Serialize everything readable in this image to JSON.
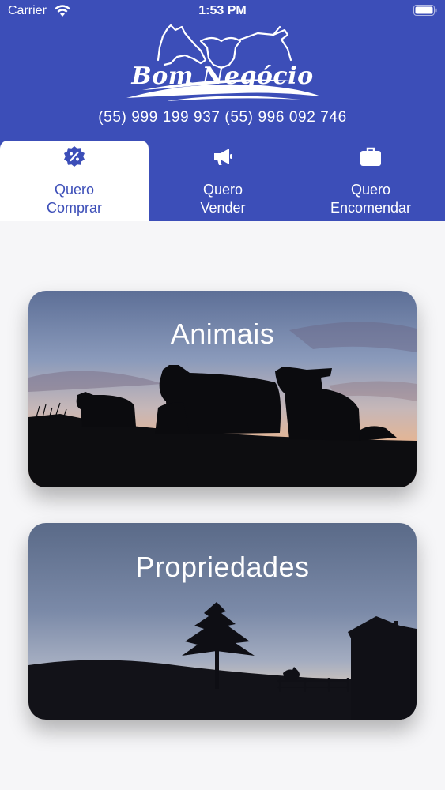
{
  "status_bar": {
    "carrier": "Carrier",
    "time": "1:53 PM"
  },
  "header": {
    "logo_text": "Bom Negócio",
    "phones": "(55) 999 199 937 (55) 996 092 746"
  },
  "tabs": [
    {
      "line1": "Quero",
      "line2": "Comprar",
      "icon": "discount-badge-icon",
      "active": true
    },
    {
      "line1": "Quero",
      "line2": "Vender",
      "icon": "megaphone-icon",
      "active": false
    },
    {
      "line1": "Quero",
      "line2": "Encomendar",
      "icon": "briefcase-icon",
      "active": false
    }
  ],
  "cards": [
    {
      "title": "Animais"
    },
    {
      "title": "Propriedades"
    }
  ],
  "colors": {
    "brand": "#3c4eb8",
    "background": "#f6f6f8"
  }
}
